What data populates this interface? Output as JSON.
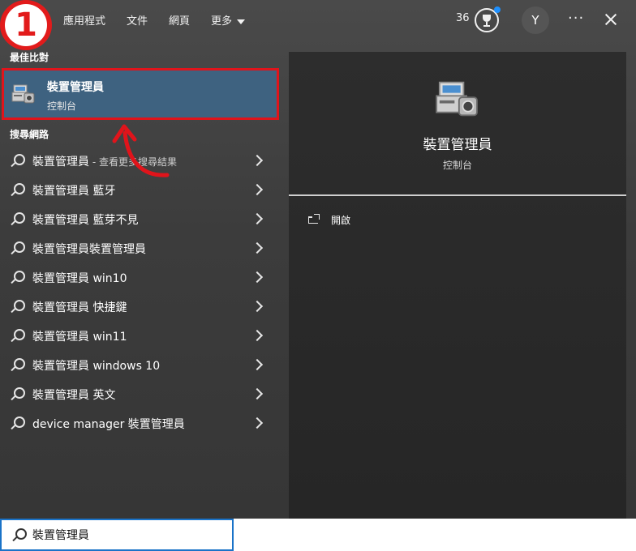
{
  "header": {
    "step_number": "1",
    "tabs": [
      {
        "label": "應用程式"
      },
      {
        "label": "文件"
      },
      {
        "label": "網頁"
      },
      {
        "label": "更多"
      }
    ],
    "points": "36",
    "avatar_initial": "Y",
    "more_label": "···"
  },
  "best_match": {
    "section_title": "最佳比對",
    "name": "裝置管理員",
    "type": "控制台",
    "icon": "device-manager-icon"
  },
  "web_search": {
    "section_title": "搜尋網路",
    "results": [
      {
        "label": "裝置管理員",
        "suffix": " - 查看更多搜尋結果"
      },
      {
        "label": "裝置管理員 藍牙",
        "suffix": ""
      },
      {
        "label": "裝置管理員 藍芽不見",
        "suffix": ""
      },
      {
        "label": "裝置管理員裝置管理員",
        "suffix": ""
      },
      {
        "label": "裝置管理員 win10",
        "suffix": ""
      },
      {
        "label": "裝置管理員 快捷鍵",
        "suffix": ""
      },
      {
        "label": "裝置管理員 win11",
        "suffix": ""
      },
      {
        "label": "裝置管理員 windows 10",
        "suffix": ""
      },
      {
        "label": "裝置管理員 英文",
        "suffix": ""
      },
      {
        "label": "device manager 裝置管理員",
        "suffix": ""
      }
    ]
  },
  "detail": {
    "title": "裝置管理員",
    "subtitle": "控制台",
    "actions": [
      {
        "label": "開啟",
        "icon": "open-icon"
      }
    ]
  },
  "search": {
    "value": "裝置管理員"
  },
  "colors": {
    "highlight": "#3e6280",
    "annotation": "#e0141b",
    "search_border": "#1a73c8"
  }
}
